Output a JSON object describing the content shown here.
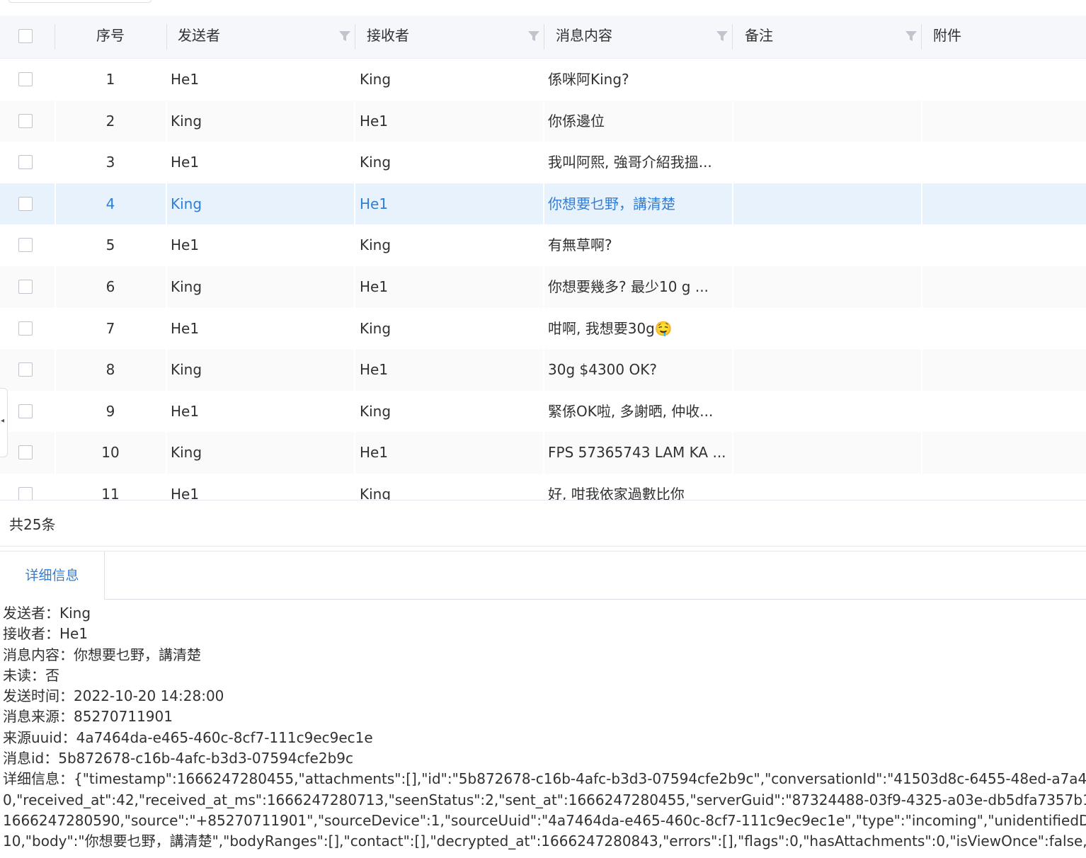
{
  "columns": {
    "index": "序号",
    "sender": "发送者",
    "receiver": "接收者",
    "content": "消息内容",
    "remark": "备注",
    "attachment": "附件"
  },
  "rows": [
    {
      "index": "1",
      "sender": "He1",
      "receiver": "King",
      "content": "係咪阿King?"
    },
    {
      "index": "2",
      "sender": "King",
      "receiver": "He1",
      "content": "你係邊位"
    },
    {
      "index": "3",
      "sender": "He1",
      "receiver": "King",
      "content": "我叫阿熙, 強哥介紹我搵..."
    },
    {
      "index": "4",
      "sender": "King",
      "receiver": "He1",
      "content": "你想要乜野，講清楚"
    },
    {
      "index": "5",
      "sender": "He1",
      "receiver": "King",
      "content": "有無草啊?"
    },
    {
      "index": "6",
      "sender": "King",
      "receiver": "He1",
      "content": "你想要幾多?  最少10 g ..."
    },
    {
      "index": "7",
      "sender": "He1",
      "receiver": "King",
      "content": "咁啊, 我想要30g🤤"
    },
    {
      "index": "8",
      "sender": "King",
      "receiver": "He1",
      "content": "30g $4300 OK?"
    },
    {
      "index": "9",
      "sender": "He1",
      "receiver": "King",
      "content": "緊係OK啦, 多謝晒, 仲收..."
    },
    {
      "index": "10",
      "sender": "King",
      "receiver": "He1",
      "content": "FPS 57365743 LAM KA ..."
    },
    {
      "index": "11",
      "sender": "He1",
      "receiver": "King",
      "content": "好, 咁我依家過數比你"
    }
  ],
  "selected_row": 4,
  "footer": {
    "total": "共25条"
  },
  "detail_tab": "详细信息",
  "details": [
    "发送者：King",
    "接收者：He1",
    "消息内容：你想要乜野，講清楚",
    "未读：否",
    "发送时间：2022-10-20 14:28:00",
    "消息来源：85270711901",
    "来源uuid：4a7464da-e465-460c-8cf7-111c9ec9ec1e",
    "消息id：5b872678-c16b-4afc-b3d3-07594cfe2b9c",
    "详细信息：{\"timestamp\":1666247280455,\"attachments\":[],\"id\":\"5b872678-c16b-4afc-b3d3-07594cfe2b9c\",\"conversationId\":\"41503d8c-6455-48ed-a7a4",
    "0,\"received_at\":42,\"received_at_ms\":1666247280713,\"seenStatus\":2,\"sent_at\":1666247280455,\"serverGuid\":\"87324488-03f9-4325-a03e-db5dfa7357b1\",",
    "1666247280590,\"source\":\"+85270711901\",\"sourceDevice\":1,\"sourceUuid\":\"4a7464da-e465-460c-8cf7-111c9ec9ec1e\",\"type\":\"incoming\",\"unidentifiedD",
    "10,\"body\":\"你想要乜野，講清楚\",\"bodyRanges\":[],\"contact\":[],\"decrypted_at\":1666247280843,\"errors\":[],\"flags\":0,\"hasAttachments\":0,\"isViewOnce\":false,\""
  ],
  "colors": {
    "accent": "#2f7ed8",
    "selected_row_bg": "#e8f2fd",
    "header_bg": "#f5f7fa"
  },
  "icons": {
    "filter": "filter-icon",
    "checkbox": "checkbox-icon",
    "collapse": "collapse-arrow-icon"
  }
}
